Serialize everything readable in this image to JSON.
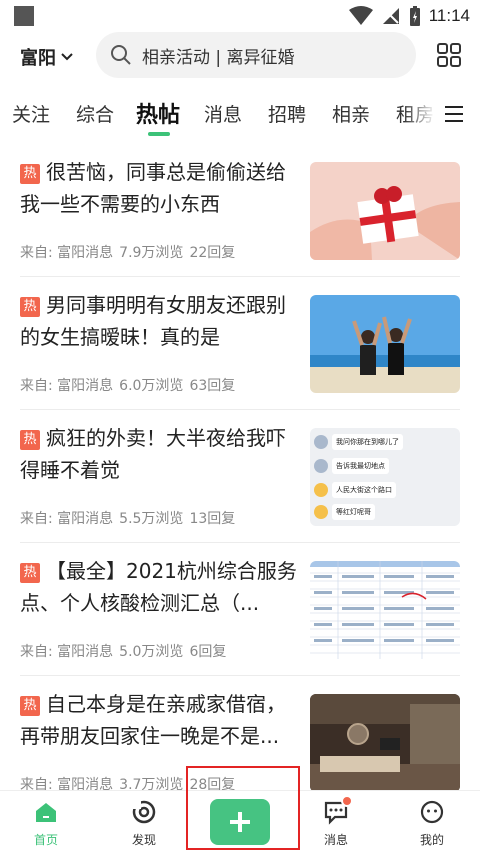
{
  "status_bar": {
    "time": "11:14"
  },
  "header": {
    "city": "富阳",
    "search_placeholder": "相亲活动 | 离异征婚"
  },
  "tabs": [
    {
      "label": "关注"
    },
    {
      "label": "综合"
    },
    {
      "label": "热帖",
      "active": true
    },
    {
      "label": "消息"
    },
    {
      "label": "招聘"
    },
    {
      "label": "相亲"
    },
    {
      "label": "租房"
    }
  ],
  "feed": [
    {
      "badge": "热",
      "title": "很苦恼，同事总是偷偷送给我一些不需要的小东西",
      "source": "来自: 富阳消息",
      "views": "7.9万浏览",
      "replies": "22回复"
    },
    {
      "badge": "热",
      "title": "男同事明明有女朋友还跟别的女生搞暧昧！真的是",
      "source": "来自: 富阳消息",
      "views": "6.0万浏览",
      "replies": "63回复"
    },
    {
      "badge": "热",
      "title": "疯狂的外卖！大半夜给我吓得睡不着觉",
      "source": "来自: 富阳消息",
      "views": "5.5万浏览",
      "replies": "13回复",
      "chat_lines": [
        "我问你那在到哪儿了",
        "告诉我最切地点",
        "人民大街这个路口",
        "等红灯呢哥"
      ]
    },
    {
      "badge": "热",
      "title": "【最全】2021杭州综合服务点、个人核酸检测汇总（...",
      "source": "来自: 富阳消息",
      "views": "5.0万浏览",
      "replies": "6回复"
    },
    {
      "badge": "热",
      "title": "自己本身是在亲戚家借宿，再带朋友回家住一晚是不是...",
      "source": "来自: 富阳消息",
      "views": "3.7万浏览",
      "replies": "28回复"
    }
  ],
  "bottom_nav": {
    "home": "首页",
    "discover": "发现",
    "messages": "消息",
    "mine": "我的"
  },
  "colors": {
    "accent": "#3cc278",
    "hot": "#f2664d",
    "highlight": "#e32424"
  }
}
